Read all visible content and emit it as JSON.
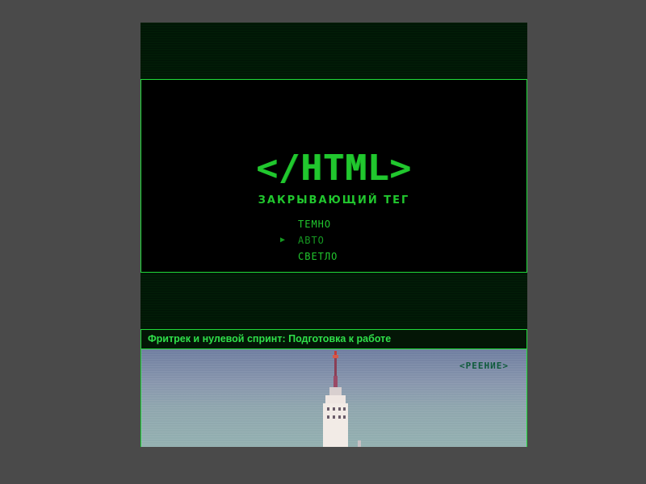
{
  "hero": {
    "logo": "</HTML>",
    "subtitle": "ЗАКРЫВАЮЩИЙ ТЕГ",
    "theme_menu": [
      {
        "label": "ТЕМНО",
        "selected": false
      },
      {
        "label": "АВТО",
        "selected": true
      },
      {
        "label": "СВЕТЛО",
        "selected": false
      }
    ],
    "selected_marker": "▶"
  },
  "article_card": {
    "title": "Фритрек и нулевой спринт: Подготовка к работе",
    "badge": "<РЕЕНИЕ>"
  },
  "colors": {
    "accent": "#21c72e",
    "border": "#20d93a",
    "page_bg": "#4a4a4a",
    "panel_bg": "#000000"
  }
}
